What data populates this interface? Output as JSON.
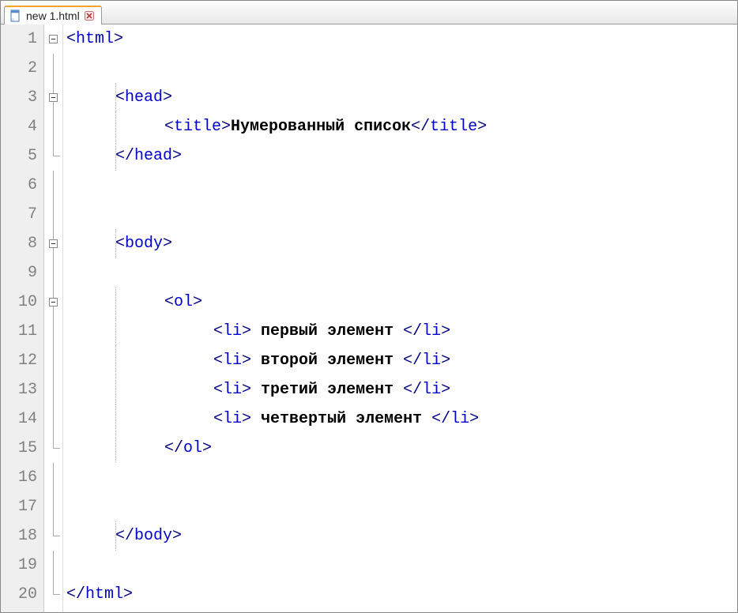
{
  "tab": {
    "filename": "new  1.html"
  },
  "editor": {
    "line_count": 20,
    "lines": [
      {
        "n": 1,
        "indent": 0,
        "fold": "box",
        "tokens": [
          [
            "bracket",
            "<"
          ],
          [
            "tag",
            "html"
          ],
          [
            "bracket",
            ">"
          ]
        ]
      },
      {
        "n": 2,
        "indent": 0,
        "fold": "line",
        "tokens": []
      },
      {
        "n": 3,
        "indent": 1,
        "fold": "box",
        "tokens": [
          [
            "bracket",
            "<"
          ],
          [
            "tag",
            "head"
          ],
          [
            "bracket",
            ">"
          ]
        ]
      },
      {
        "n": 4,
        "indent": 2,
        "fold": "line",
        "tokens": [
          [
            "bracket",
            "<"
          ],
          [
            "tag",
            "title"
          ],
          [
            "bracket",
            ">"
          ],
          [
            "text",
            "Нумерованный список"
          ],
          [
            "bracket",
            "</"
          ],
          [
            "tag",
            "title"
          ],
          [
            "bracket",
            ">"
          ]
        ]
      },
      {
        "n": 5,
        "indent": 1,
        "fold": "end",
        "tokens": [
          [
            "bracket",
            "</"
          ],
          [
            "tag",
            "head"
          ],
          [
            "bracket",
            ">"
          ]
        ]
      },
      {
        "n": 6,
        "indent": 0,
        "fold": "line",
        "tokens": []
      },
      {
        "n": 7,
        "indent": 0,
        "fold": "line",
        "tokens": []
      },
      {
        "n": 8,
        "indent": 1,
        "fold": "box",
        "tokens": [
          [
            "bracket",
            "<"
          ],
          [
            "tag",
            "body"
          ],
          [
            "bracket",
            ">"
          ]
        ]
      },
      {
        "n": 9,
        "indent": 0,
        "fold": "line",
        "tokens": []
      },
      {
        "n": 10,
        "indent": 2,
        "fold": "box",
        "tokens": [
          [
            "bracket",
            "<"
          ],
          [
            "tag",
            "ol"
          ],
          [
            "bracket",
            ">"
          ]
        ]
      },
      {
        "n": 11,
        "indent": 3,
        "fold": "line",
        "tokens": [
          [
            "bracket",
            "<"
          ],
          [
            "tag",
            "li"
          ],
          [
            "bracket",
            ">"
          ],
          [
            "text",
            " первый элемент "
          ],
          [
            "bracket",
            "</"
          ],
          [
            "tag",
            "li"
          ],
          [
            "bracket",
            ">"
          ]
        ]
      },
      {
        "n": 12,
        "indent": 3,
        "fold": "line",
        "tokens": [
          [
            "bracket",
            "<"
          ],
          [
            "tag",
            "li"
          ],
          [
            "bracket",
            ">"
          ],
          [
            "text",
            " второй элемент "
          ],
          [
            "bracket",
            "</"
          ],
          [
            "tag",
            "li"
          ],
          [
            "bracket",
            ">"
          ]
        ]
      },
      {
        "n": 13,
        "indent": 3,
        "fold": "line",
        "tokens": [
          [
            "bracket",
            "<"
          ],
          [
            "tag",
            "li"
          ],
          [
            "bracket",
            ">"
          ],
          [
            "text",
            " третий элемент "
          ],
          [
            "bracket",
            "</"
          ],
          [
            "tag",
            "li"
          ],
          [
            "bracket",
            ">"
          ]
        ]
      },
      {
        "n": 14,
        "indent": 3,
        "fold": "line",
        "tokens": [
          [
            "bracket",
            "<"
          ],
          [
            "tag",
            "li"
          ],
          [
            "bracket",
            ">"
          ],
          [
            "text",
            " четвертый элемент "
          ],
          [
            "bracket",
            "</"
          ],
          [
            "tag",
            "li"
          ],
          [
            "bracket",
            ">"
          ]
        ]
      },
      {
        "n": 15,
        "indent": 2,
        "fold": "end",
        "tokens": [
          [
            "bracket",
            "</"
          ],
          [
            "tag",
            "ol"
          ],
          [
            "bracket",
            ">"
          ]
        ]
      },
      {
        "n": 16,
        "indent": 0,
        "fold": "line",
        "tokens": []
      },
      {
        "n": 17,
        "indent": 0,
        "fold": "line",
        "tokens": []
      },
      {
        "n": 18,
        "indent": 1,
        "fold": "end",
        "tokens": [
          [
            "bracket",
            "</"
          ],
          [
            "tag",
            "body"
          ],
          [
            "bracket",
            ">"
          ]
        ]
      },
      {
        "n": 19,
        "indent": 0,
        "fold": "line",
        "tokens": []
      },
      {
        "n": 20,
        "indent": 0,
        "fold": "end",
        "tokens": [
          [
            "bracket",
            "</"
          ],
          [
            "tag",
            "html"
          ],
          [
            "bracket",
            ">"
          ]
        ]
      }
    ]
  }
}
